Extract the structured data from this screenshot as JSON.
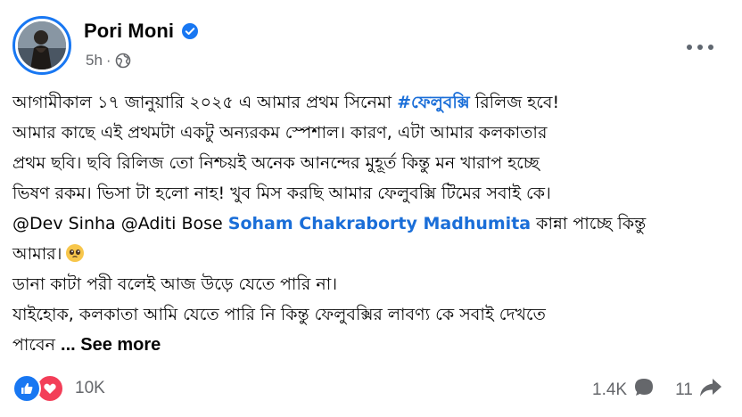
{
  "post": {
    "author": "Pori Moni",
    "time": "5h",
    "privacy_icon": "globe-icon",
    "verified_color": "#1877f2",
    "link_color": "#1a6ed8",
    "body": {
      "line1_pre": "আগামীকাল ১৭ জানুয়ারি ২০২৫ এ আমার প্রথম সিনেমা ",
      "line1_hashtag": "#ফেলুবক্সি",
      "line1_post": " রিলিজ হবে!",
      "line2": "আমার কাছে এই প্রথমটা একটু অন্যরকম স্পেশাল। কারণ, এটা আমার কলকাতার",
      "line3": "প্রথম ছবি। ছবি রিলিজ তো নিশ্চয়ই অনেক আনন্দের মুহূর্ত কিন্তু মন খারাপ হচ্ছে",
      "line4": "ভিষণ রকম। ভিসা টা হলো নাহ! খুব মিস করছি আমার ফেলুবক্সি টিমের সবাই কে।",
      "line5_mentions_plain": "@Dev Sinha @Aditi Bose ",
      "line5_mentions_link": "Soham Chakraborty Madhumita",
      "line5_post": " কান্না পাচ্ছে কিন্তু",
      "line6": "আমার।",
      "line6_emoji": "pleading-face-emoji",
      "line7": "ডানা কাটা পরী বলেই আজ উড়ে যেতে পারি না।",
      "line8": "যাইহোক, কলকাতা আমি যেতে পারি নি কিন্তু ফেলুবক্সির লাবণ্য কে সবাই দেখতে",
      "line9_pre": "পাবেন",
      "see_more": "... See more"
    },
    "footer": {
      "reaction_count": "10K",
      "comments_count": "1.4K",
      "shares_count": "11",
      "like_color": "#1877f2",
      "love_color": "#f33e58"
    }
  }
}
